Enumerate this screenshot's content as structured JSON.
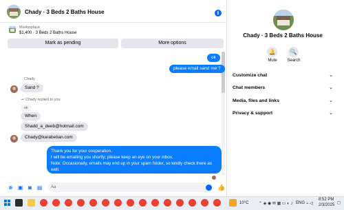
{
  "header": {
    "title": "Chady · 3 Beds 2 Baths House"
  },
  "marketplace": {
    "label": "Marketplace",
    "listing": "$1,400 · 3 Beds 2 Baths House"
  },
  "actions": {
    "mark_pending": "Mark as pending",
    "more_options": "More options"
  },
  "messages": {
    "out1": "ok",
    "out2": "please email sand me ?",
    "sender": "Chady",
    "in1": "Sand ?",
    "reply_note": "Chady replied to you",
    "quoted": "ok",
    "in2": "When",
    "in3": "Shadd_a_deeb@hotmail.com",
    "in4": "Chady@karabetian.com",
    "long_line1": "Thank you for your cooperation.",
    "long_line2": "I will be emailing you shortly; please keep an eye on your inbox.",
    "long_line3": "Note: Occasionally, emails may end up in your spam folder, so kindly check there as well."
  },
  "composer": {
    "placeholder": "Aa"
  },
  "details": {
    "title": "Chady · 3 Beds 2 Baths House",
    "mute": "Mute",
    "search": "Search",
    "menu": [
      "Customize chat",
      "Chat members",
      "Media, files and links",
      "Privacy & support"
    ]
  },
  "taskbar": {
    "temperature": "10°C",
    "language": "ENG",
    "time": "8:52 PM",
    "date": "2/3/2025"
  },
  "colors": {
    "accent": "#0866ff",
    "bubble_out": "#0a7cff",
    "bubble_in": "#e4e6eb"
  }
}
